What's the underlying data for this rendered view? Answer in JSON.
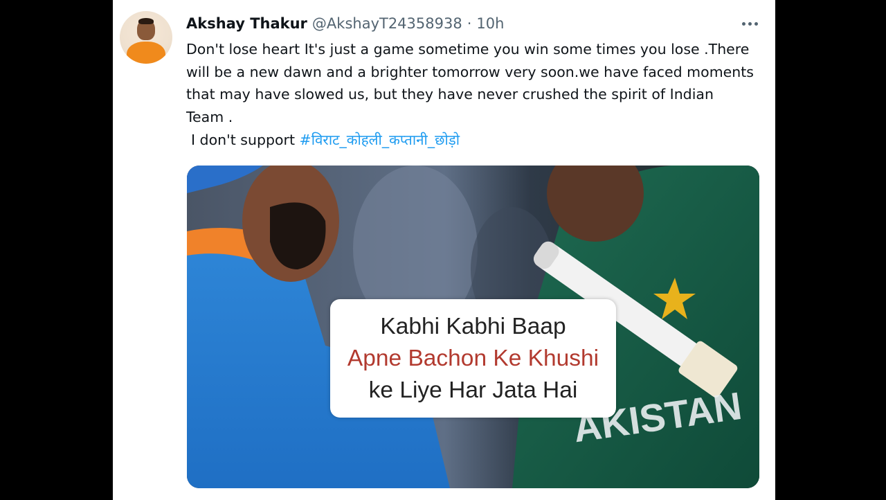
{
  "tweet": {
    "author_name": "Akshay Thakur",
    "author_handle": "@AkshayT24358938",
    "separator": "·",
    "timestamp": "10h",
    "text_main": "Don't lose heart It's just a game sometime you win some times you lose .There will be a new dawn and a brighter tomorrow very soon.we have faced moments that may have slowed us, but they have never crushed the spirit of Indian Team .",
    "text_support_prefix": "I don't  support",
    "hashtag": "#विराट_कोहली_कप्तानी_छोड़ो",
    "hashtag_color": "#1d9bf0",
    "media": {
      "caption_line1": "Kabhi Kabhi Baap",
      "caption_line2": "Apne Bachon Ke Khushi",
      "caption_line3": "ke Liye Har Jata Hai",
      "caption_accent_color": "#b23a2f",
      "jersey_lettering": "AKISTAN"
    }
  },
  "icons": {
    "more": "more-horizontal-icon",
    "avatar": "profile-avatar"
  },
  "colors": {
    "text": "#0f1419",
    "secondary": "#536471",
    "background": "#ffffff"
  }
}
